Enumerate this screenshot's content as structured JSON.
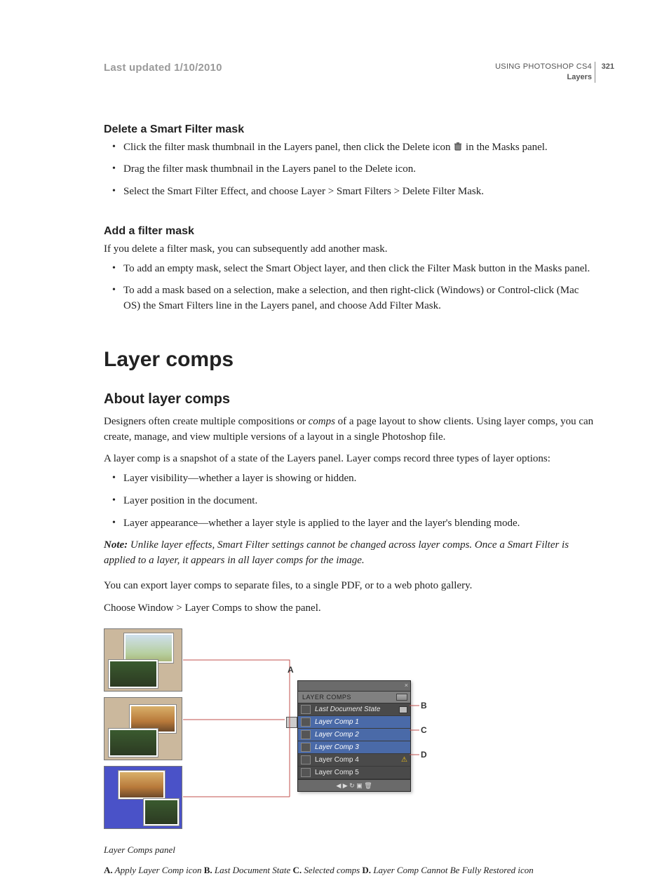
{
  "header": {
    "last_updated": "Last updated 1/10/2010",
    "doc_title": "USING PHOTOSHOP CS4",
    "chapter": "Layers",
    "page_number": "321"
  },
  "section_delete": {
    "heading": "Delete a Smart Filter mask",
    "bullets": [
      {
        "pre": "Click the filter mask thumbnail in the Layers panel, then click the Delete icon ",
        "post": " in the Masks panel."
      },
      {
        "pre": "Drag the filter mask thumbnail in the Layers panel to the Delete icon.",
        "post": ""
      },
      {
        "pre": "Select the Smart Filter Effect, and choose Layer > Smart Filters > Delete Filter Mask.",
        "post": ""
      }
    ]
  },
  "section_add": {
    "heading": "Add a filter mask",
    "intro": "If you delete a filter mask, you can subsequently add another mask.",
    "bullets": [
      "To add an empty mask, select the Smart Object layer, and then click the Filter Mask button in the Masks panel.",
      "To add a mask based on a selection, make a selection, and then right-click (Windows) or Control-click (Mac OS) the Smart Filters line in the Layers panel, and choose Add Filter Mask."
    ]
  },
  "chapter_title": "Layer comps",
  "topic": {
    "heading": "About layer comps",
    "paras": [
      {
        "pre": "Designers often create multiple compositions or ",
        "em": "comps",
        "post": " of a page layout to show clients. Using layer comps, you can create, manage, and view multiple versions of a layout in a single Photoshop file."
      },
      {
        "pre": "A layer comp is a snapshot of a state of the Layers panel. Layer comps record three types of layer options:",
        "em": "",
        "post": ""
      }
    ],
    "bullets": [
      "Layer visibility—whether a layer is showing or hidden.",
      "Layer position in the document.",
      "Layer appearance—whether a layer style is applied to the layer and the layer's blending mode."
    ],
    "note_label": "Note:",
    "note": " Unlike layer effects, Smart Filter settings cannot be changed across layer comps. Once a Smart Filter is applied to a layer, it appears in all layer comps for the image.",
    "para_export": "You can export layer comps to separate files, to a single PDF, or to a web photo gallery.",
    "para_show": "Choose Window > Layer Comps to show the panel."
  },
  "panel": {
    "title": "LAYER COMPS",
    "rows": [
      {
        "label": "Last Document State",
        "kind": "last"
      },
      {
        "label": "Layer Comp 1",
        "kind": "selected"
      },
      {
        "label": "Layer Comp 2",
        "kind": "selected"
      },
      {
        "label": "Layer Comp 3",
        "kind": "selected"
      },
      {
        "label": "Layer Comp 4",
        "kind": "warn"
      },
      {
        "label": "Layer Comp 5",
        "kind": "normal"
      }
    ],
    "footer_glyphs": "◀  ▶  ↻  ▣  🗑"
  },
  "callouts": {
    "A": "A",
    "B": "B",
    "C": "C",
    "D": "D"
  },
  "caption": {
    "title": "Layer Comps panel",
    "key_parts": {
      "A_k": "A.",
      "A_t": " Apply Layer Comp icon  ",
      "B_k": "B.",
      "B_t": " Last Document State  ",
      "C_k": "C.",
      "C_t": " Selected comps  ",
      "D_k": "D.",
      "D_t": " Layer Comp Cannot Be Fully Restored icon"
    }
  }
}
